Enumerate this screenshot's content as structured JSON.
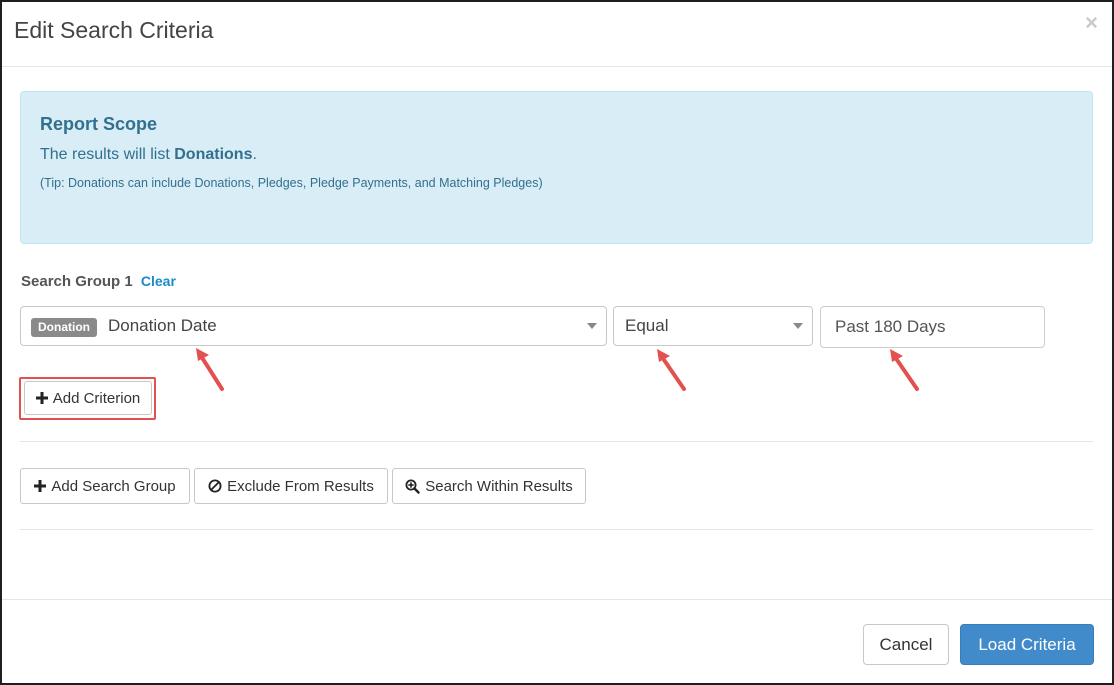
{
  "modal": {
    "title": "Edit Search Criteria",
    "close_glyph": "×"
  },
  "scope": {
    "title": "Report Scope",
    "text_prefix": "The results will list ",
    "text_bold": "Donations",
    "text_suffix": ".",
    "tip": "(Tip: Donations can include Donations, Pledges, Pledge Payments, and Matching Pledges)"
  },
  "group": {
    "label": "Search Group 1",
    "clear_label": "Clear"
  },
  "criterion": {
    "field_badge": "Donation",
    "field_value": "Donation Date",
    "operator_value": "Equal",
    "value": "Past 180 Days"
  },
  "buttons": {
    "add_criterion": "Add Criterion",
    "add_search_group": "Add Search Group",
    "exclude_from_results": "Exclude From Results",
    "search_within_results": "Search Within Results",
    "cancel": "Cancel",
    "load_criteria": "Load Criteria"
  },
  "icons": {
    "plus": "plus-icon",
    "ban": "ban-icon",
    "zoom": "zoom-in-icon",
    "caret": "caret-down-icon",
    "arrow": "red-arrow-icon"
  },
  "colors": {
    "scope_bg": "#d9edf7",
    "scope_text": "#31708f",
    "primary": "#428bca",
    "link": "#1a8bc7",
    "annotation": "#e35050",
    "badge": "#8a8a8a"
  }
}
